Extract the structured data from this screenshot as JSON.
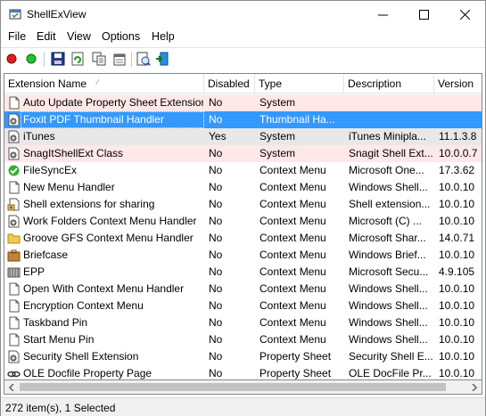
{
  "window": {
    "title": "ShellExView"
  },
  "menu": [
    "File",
    "Edit",
    "View",
    "Options",
    "Help"
  ],
  "toolbar": {
    "icons": [
      "disable-red-icon",
      "enable-green-icon",
      "save-icon",
      "refresh-icon",
      "copy-icon",
      "properties-icon",
      "html-report-icon",
      "exit-icon"
    ]
  },
  "columns": [
    "Extension Name",
    "Disabled",
    "Type",
    "Description",
    "Version"
  ],
  "rows": [
    {
      "name": "Auto Update Property Sheet Extension",
      "disabled": "No",
      "type": "System",
      "description": "",
      "version": "",
      "style": "hl-red",
      "icon": "doc"
    },
    {
      "name": "Foxit PDF Thumbnail Handler",
      "disabled": "No",
      "type": "Thumbnail Ha...",
      "description": "",
      "version": "",
      "style": "selected",
      "icon": "doc-gear"
    },
    {
      "name": "iTunes",
      "disabled": "Yes",
      "type": "System",
      "description": "iTunes Minipla...",
      "version": "11.1.3.8",
      "style": "hl-gray",
      "icon": "doc-gear"
    },
    {
      "name": "SnagItShellExt Class",
      "disabled": "No",
      "type": "System",
      "description": "Snagit Shell Ext...",
      "version": "10.0.0.7",
      "style": "hl-red",
      "icon": "doc-gear"
    },
    {
      "name": "FileSyncEx",
      "disabled": "No",
      "type": "Context Menu",
      "description": "Microsoft One...",
      "version": "17.3.62",
      "style": "",
      "icon": "check"
    },
    {
      "name": "New Menu Handler",
      "disabled": "No",
      "type": "Context Menu",
      "description": "Windows Shell...",
      "version": "10.0.10",
      "style": "",
      "icon": "doc"
    },
    {
      "name": "Shell extensions for sharing",
      "disabled": "No",
      "type": "Context Menu",
      "description": "Shell extension...",
      "version": "10.0.10",
      "style": "",
      "icon": "share"
    },
    {
      "name": "Work Folders Context Menu Handler",
      "disabled": "No",
      "type": "Context Menu",
      "description": "Microsoft (C) ...",
      "version": "10.0.10",
      "style": "",
      "icon": "doc-gear"
    },
    {
      "name": "Groove GFS Context Menu Handler",
      "disabled": "No",
      "type": "Context Menu",
      "description": "Microsoft Shar...",
      "version": "14.0.71",
      "style": "",
      "icon": "folder"
    },
    {
      "name": "Briefcase",
      "disabled": "No",
      "type": "Context Menu",
      "description": "Windows Brief...",
      "version": "10.0.10",
      "style": "",
      "icon": "briefcase"
    },
    {
      "name": "EPP",
      "disabled": "No",
      "type": "Context Menu",
      "description": "Microsoft Secu...",
      "version": "4.9.105",
      "style": "",
      "icon": "epp"
    },
    {
      "name": "Open With Context Menu Handler",
      "disabled": "No",
      "type": "Context Menu",
      "description": "Windows Shell...",
      "version": "10.0.10",
      "style": "",
      "icon": "doc"
    },
    {
      "name": "Encryption Context Menu",
      "disabled": "No",
      "type": "Context Menu",
      "description": "Windows Shell...",
      "version": "10.0.10",
      "style": "",
      "icon": "doc"
    },
    {
      "name": "Taskband Pin",
      "disabled": "No",
      "type": "Context Menu",
      "description": "Windows Shell...",
      "version": "10.0.10",
      "style": "",
      "icon": "doc"
    },
    {
      "name": "Start Menu Pin",
      "disabled": "No",
      "type": "Context Menu",
      "description": "Windows Shell...",
      "version": "10.0.10",
      "style": "",
      "icon": "doc"
    },
    {
      "name": "Security Shell Extension",
      "disabled": "No",
      "type": "Property Sheet",
      "description": "Security Shell E...",
      "version": "10.0.10",
      "style": "",
      "icon": "doc-gear"
    },
    {
      "name": "OLE Docfile Property Page",
      "disabled": "No",
      "type": "Property Sheet",
      "description": "OLE DocFile Pr...",
      "version": "10.0.10",
      "style": "",
      "icon": "link"
    }
  ],
  "status": {
    "text": "272 item(s), 1 Selected"
  },
  "colors": {
    "selected": "#3399ff",
    "hl_red": "#ffe8e8",
    "hl_gray": "#e8e8e8"
  }
}
